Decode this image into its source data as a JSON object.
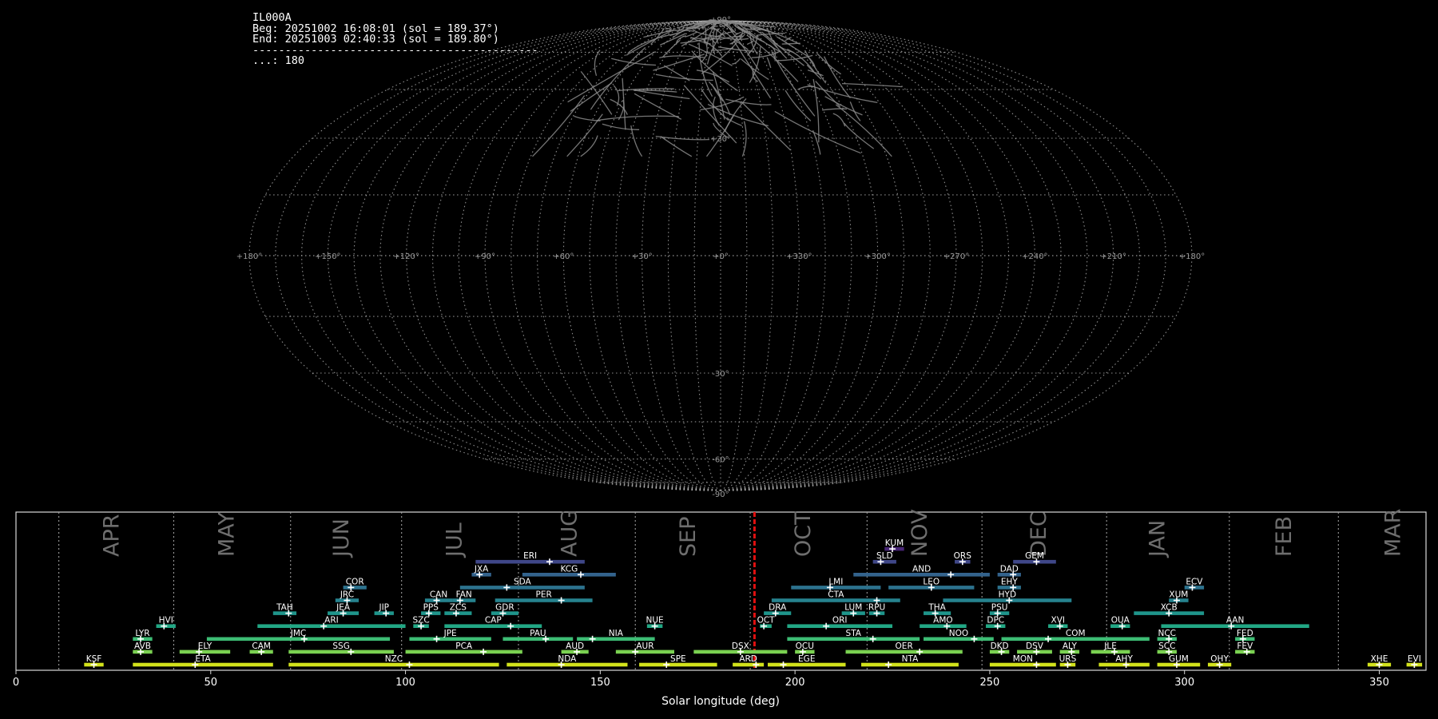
{
  "header": {
    "station": "IL000A",
    "begin": "Beg: 20251002 16:08:01 (sol = 189.37°)",
    "end": "End: 20251003 02:40:33 (sol = 189.80°)",
    "separator": "--------------------------------------------",
    "count": "...: 180"
  },
  "chart_data": [
    {
      "type": "scatter",
      "title": "",
      "projection": "sinusoidal all-sky map",
      "lon_tick_labels": [
        "+180°",
        "+150°",
        "+120°",
        "+90°",
        "+60°",
        "+30°",
        "+0°",
        "+330°",
        "+300°",
        "+270°",
        "+240°",
        "+210°",
        "+180°"
      ],
      "lat_tick_labels": [
        "+90°",
        "+30°",
        "-30°",
        "-60°",
        "-90°"
      ],
      "grid": true,
      "grid_color": "#bdbdbd",
      "track_color": "#8a8a8a",
      "track_count": 180
    },
    {
      "type": "bar",
      "title": "",
      "xlabel": "Solar longitude (deg)",
      "xlim": [
        0,
        362
      ],
      "x_ticks": [
        0,
        50,
        100,
        150,
        200,
        250,
        300,
        350
      ],
      "current_sol": 189.6,
      "month_boundaries": [
        11,
        40.5,
        70.5,
        99,
        129,
        159,
        188.5,
        218.5,
        248,
        280,
        311.5,
        339.5
      ],
      "months": [
        {
          "label": "APR",
          "x": 24.5
        },
        {
          "label": "MAY",
          "x": 54
        },
        {
          "label": "JUN",
          "x": 83.5
        },
        {
          "label": "JUL",
          "x": 112.5
        },
        {
          "label": "AUG",
          "x": 142
        },
        {
          "label": "SEP",
          "x": 172.5
        },
        {
          "label": "OCT",
          "x": 202
        },
        {
          "label": "NOV",
          "x": 232
        },
        {
          "label": "DEC",
          "x": 262.5
        },
        {
          "label": "JAN",
          "x": 293
        },
        {
          "label": "FEB",
          "x": 325.5
        },
        {
          "label": "MAR",
          "x": 353.5
        }
      ],
      "showers": [
        {
          "code": "KSF",
          "row": 0,
          "start": 17.5,
          "end": 22.5,
          "peak": 20,
          "color": "#d2e21b"
        },
        {
          "code": "ETA",
          "row": 0,
          "start": 30,
          "end": 66,
          "peak": 46,
          "color": "#d2e21b"
        },
        {
          "code": "NZC",
          "row": 0,
          "start": 70,
          "end": 124,
          "peak": 101,
          "color": "#d2e21b"
        },
        {
          "code": "NDA",
          "row": 0,
          "start": 126,
          "end": 157,
          "peak": 140,
          "color": "#d2e21b"
        },
        {
          "code": "SPE",
          "row": 0,
          "start": 160,
          "end": 180,
          "peak": 167,
          "color": "#d2e21b"
        },
        {
          "code": "ARD",
          "row": 0,
          "start": 184,
          "end": 192,
          "peak": 190,
          "color": "#d2e21b"
        },
        {
          "code": "EGE",
          "row": 0,
          "start": 193,
          "end": 213,
          "peak": 197,
          "color": "#d2e21b"
        },
        {
          "code": "NTA",
          "row": 0,
          "start": 217,
          "end": 242,
          "peak": 224,
          "color": "#d2e21b"
        },
        {
          "code": "MON",
          "row": 0,
          "start": 250,
          "end": 267,
          "peak": 262,
          "color": "#d2e21b"
        },
        {
          "code": "URS",
          "row": 0,
          "start": 268,
          "end": 272,
          "peak": 270,
          "color": "#d2e21b"
        },
        {
          "code": "AHY",
          "row": 0,
          "start": 278,
          "end": 291,
          "peak": 285,
          "color": "#d2e21b"
        },
        {
          "code": "GUM",
          "row": 0,
          "start": 293,
          "end": 304,
          "peak": 298,
          "color": "#d2e21b"
        },
        {
          "code": "OHY",
          "row": 0,
          "start": 306,
          "end": 312,
          "peak": 309,
          "color": "#d2e21b"
        },
        {
          "code": "XHE",
          "row": 0,
          "start": 347,
          "end": 353,
          "peak": 350,
          "color": "#d2e21b"
        },
        {
          "code": "EVI",
          "row": 0,
          "start": 357,
          "end": 361,
          "peak": 359,
          "color": "#d2e21b"
        },
        {
          "code": "AVB",
          "row": 1,
          "start": 30,
          "end": 35,
          "peak": 32,
          "color": "#7ad151"
        },
        {
          "code": "ELY",
          "row": 1,
          "start": 42,
          "end": 55,
          "peak": 47,
          "color": "#7ad151"
        },
        {
          "code": "CAM",
          "row": 1,
          "start": 60,
          "end": 66,
          "peak": 63,
          "color": "#7ad151"
        },
        {
          "code": "SSG",
          "row": 1,
          "start": 70,
          "end": 97,
          "peak": 86,
          "color": "#7ad151"
        },
        {
          "code": "PCA",
          "row": 1,
          "start": 100,
          "end": 130,
          "peak": 120,
          "color": "#7ad151"
        },
        {
          "code": "AUD",
          "row": 1,
          "start": 140,
          "end": 147,
          "peak": 144,
          "color": "#7ad151"
        },
        {
          "code": "AUR",
          "row": 1,
          "start": 154,
          "end": 169,
          "peak": 159,
          "color": "#7ad151"
        },
        {
          "code": "DSX",
          "row": 1,
          "start": 174,
          "end": 198,
          "peak": 186,
          "color": "#7ad151"
        },
        {
          "code": "OCU",
          "row": 1,
          "start": 200,
          "end": 205,
          "peak": 202,
          "color": "#7ad151"
        },
        {
          "code": "OER",
          "row": 1,
          "start": 213,
          "end": 243,
          "peak": 232,
          "color": "#7ad151"
        },
        {
          "code": "DKD",
          "row": 1,
          "start": 250,
          "end": 255,
          "peak": 253,
          "color": "#7ad151"
        },
        {
          "code": "DSV",
          "row": 1,
          "start": 257,
          "end": 266,
          "peak": 262,
          "color": "#7ad151"
        },
        {
          "code": "ALY",
          "row": 1,
          "start": 268,
          "end": 273,
          "peak": 271,
          "color": "#7ad151"
        },
        {
          "code": "JLE",
          "row": 1,
          "start": 276,
          "end": 286,
          "peak": 282,
          "color": "#7ad151"
        },
        {
          "code": "SCC",
          "row": 1,
          "start": 293,
          "end": 298,
          "peak": 296,
          "color": "#7ad151"
        },
        {
          "code": "FEV",
          "row": 1,
          "start": 313,
          "end": 318,
          "peak": 316,
          "color": "#7ad151"
        },
        {
          "code": "LYR",
          "row": 2,
          "start": 30,
          "end": 35,
          "peak": 32,
          "color": "#3dbc74"
        },
        {
          "code": "JMC",
          "row": 2,
          "start": 49,
          "end": 96,
          "peak": 74,
          "color": "#3dbc74"
        },
        {
          "code": "JPE",
          "row": 2,
          "start": 101,
          "end": 122,
          "peak": 108,
          "color": "#3dbc74"
        },
        {
          "code": "PAU",
          "row": 2,
          "start": 125,
          "end": 143,
          "peak": 136,
          "color": "#3dbc74"
        },
        {
          "code": "NIA",
          "row": 2,
          "start": 144,
          "end": 164,
          "peak": 148,
          "color": "#3dbc74"
        },
        {
          "code": "STA",
          "row": 2,
          "start": 198,
          "end": 232,
          "peak": 220,
          "color": "#3dbc74"
        },
        {
          "code": "NOO",
          "row": 2,
          "start": 233,
          "end": 251,
          "peak": 246,
          "color": "#3dbc74"
        },
        {
          "code": "COM",
          "row": 2,
          "start": 253,
          "end": 291,
          "peak": 265,
          "color": "#3dbc74"
        },
        {
          "code": "NCC",
          "row": 2,
          "start": 293,
          "end": 298,
          "peak": 296,
          "color": "#3dbc74"
        },
        {
          "code": "FED",
          "row": 2,
          "start": 313,
          "end": 318,
          "peak": 315,
          "color": "#3dbc74"
        },
        {
          "code": "HVI",
          "row": 3,
          "start": 36,
          "end": 41,
          "peak": 38,
          "color": "#22a785"
        },
        {
          "code": "ARI",
          "row": 3,
          "start": 62,
          "end": 100,
          "peak": 79,
          "color": "#22a785"
        },
        {
          "code": "SZC",
          "row": 3,
          "start": 102,
          "end": 106,
          "peak": 104,
          "color": "#22a785"
        },
        {
          "code": "CAP",
          "row": 3,
          "start": 110,
          "end": 135,
          "peak": 127,
          "color": "#22a785"
        },
        {
          "code": "NUE",
          "row": 3,
          "start": 162,
          "end": 166,
          "peak": 164,
          "color": "#22a785"
        },
        {
          "code": "OCT",
          "row": 3,
          "start": 191,
          "end": 194,
          "peak": 192,
          "color": "#22a785"
        },
        {
          "code": "ORI",
          "row": 3,
          "start": 198,
          "end": 225,
          "peak": 208,
          "color": "#22a785"
        },
        {
          "code": "AMO",
          "row": 3,
          "start": 232,
          "end": 244,
          "peak": 239,
          "color": "#22a785"
        },
        {
          "code": "DPC",
          "row": 3,
          "start": 249,
          "end": 254,
          "peak": 252,
          "color": "#22a785"
        },
        {
          "code": "XVI",
          "row": 3,
          "start": 265,
          "end": 270,
          "peak": 268,
          "color": "#22a785"
        },
        {
          "code": "OUA",
          "row": 3,
          "start": 281,
          "end": 286,
          "peak": 284,
          "color": "#22a785"
        },
        {
          "code": "AAN",
          "row": 3,
          "start": 294,
          "end": 332,
          "peak": 312,
          "color": "#22a785"
        },
        {
          "code": "TAH",
          "row": 4,
          "start": 66,
          "end": 72,
          "peak": 70,
          "color": "#1f958b"
        },
        {
          "code": "JEA",
          "row": 4,
          "start": 80,
          "end": 88,
          "peak": 84,
          "color": "#1f958b"
        },
        {
          "code": "JIP",
          "row": 4,
          "start": 92,
          "end": 97,
          "peak": 95,
          "color": "#1f958b"
        },
        {
          "code": "PPS",
          "row": 4,
          "start": 104,
          "end": 109,
          "peak": 106,
          "color": "#1f958b"
        },
        {
          "code": "ZCS",
          "row": 4,
          "start": 110,
          "end": 117,
          "peak": 113,
          "color": "#1f958b"
        },
        {
          "code": "GDR",
          "row": 4,
          "start": 122,
          "end": 129,
          "peak": 125,
          "color": "#1f958b"
        },
        {
          "code": "DRA",
          "row": 4,
          "start": 192,
          "end": 199,
          "peak": 195,
          "color": "#1f958b"
        },
        {
          "code": "LUM",
          "row": 4,
          "start": 212,
          "end": 218,
          "peak": 215,
          "color": "#1f958b"
        },
        {
          "code": "RPU",
          "row": 4,
          "start": 219,
          "end": 223,
          "peak": 221,
          "color": "#1f958b"
        },
        {
          "code": "THA",
          "row": 4,
          "start": 233,
          "end": 240,
          "peak": 236,
          "color": "#1f958b"
        },
        {
          "code": "PSU",
          "row": 4,
          "start": 250,
          "end": 255,
          "peak": 252,
          "color": "#1f958b"
        },
        {
          "code": "XCB",
          "row": 4,
          "start": 287,
          "end": 305,
          "peak": 296,
          "color": "#1f958b"
        },
        {
          "code": "JRC",
          "row": 5,
          "start": 82,
          "end": 88,
          "peak": 85,
          "color": "#26828e"
        },
        {
          "code": "CAN",
          "row": 5,
          "start": 105,
          "end": 112,
          "peak": 108,
          "color": "#26828e"
        },
        {
          "code": "FAN",
          "row": 5,
          "start": 112,
          "end": 118,
          "peak": 114,
          "color": "#26828e"
        },
        {
          "code": "PER",
          "row": 5,
          "start": 123,
          "end": 148,
          "peak": 140,
          "color": "#26828e"
        },
        {
          "code": "CTA",
          "row": 5,
          "start": 194,
          "end": 227,
          "peak": 221,
          "color": "#26828e"
        },
        {
          "code": "HYD",
          "row": 5,
          "start": 238,
          "end": 271,
          "peak": 255,
          "color": "#26828e"
        },
        {
          "code": "XUM",
          "row": 5,
          "start": 296,
          "end": 301,
          "peak": 298,
          "color": "#26828e"
        },
        {
          "code": "COR",
          "row": 6,
          "start": 84,
          "end": 90,
          "peak": 86,
          "color": "#2c728e"
        },
        {
          "code": "SDA",
          "row": 6,
          "start": 114,
          "end": 146,
          "peak": 126,
          "color": "#2c728e"
        },
        {
          "code": "LMI",
          "row": 6,
          "start": 199,
          "end": 222,
          "peak": 209,
          "color": "#2c728e"
        },
        {
          "code": "LEO",
          "row": 6,
          "start": 224,
          "end": 246,
          "peak": 235,
          "color": "#2c728e"
        },
        {
          "code": "EHY",
          "row": 6,
          "start": 252,
          "end": 258,
          "peak": 256,
          "color": "#2c728e"
        },
        {
          "code": "ECV",
          "row": 6,
          "start": 300,
          "end": 305,
          "peak": 302,
          "color": "#2c728e"
        },
        {
          "code": "JXA",
          "row": 7,
          "start": 117,
          "end": 122,
          "peak": 119,
          "color": "#33638d"
        },
        {
          "code": "KCG",
          "row": 7,
          "start": 130,
          "end": 154,
          "peak": 145,
          "color": "#33638d"
        },
        {
          "code": "AND",
          "row": 7,
          "start": 215,
          "end": 250,
          "peak": 240,
          "color": "#33638d"
        },
        {
          "code": "DAD",
          "row": 7,
          "start": 252,
          "end": 258,
          "peak": 256,
          "color": "#33638d"
        },
        {
          "code": "ERI",
          "row": 8,
          "start": 118,
          "end": 146,
          "peak": 137,
          "color": "#3f4788"
        },
        {
          "code": "SLD",
          "row": 8,
          "start": 220,
          "end": 226,
          "peak": 222,
          "color": "#3f4788"
        },
        {
          "code": "ORS",
          "row": 8,
          "start": 241,
          "end": 245,
          "peak": 243,
          "color": "#3f4788"
        },
        {
          "code": "GEM",
          "row": 8,
          "start": 256,
          "end": 267,
          "peak": 262,
          "color": "#3f4788"
        },
        {
          "code": "KUM",
          "row": 9,
          "start": 223,
          "end": 228,
          "peak": 225,
          "color": "#482677"
        }
      ]
    }
  ]
}
